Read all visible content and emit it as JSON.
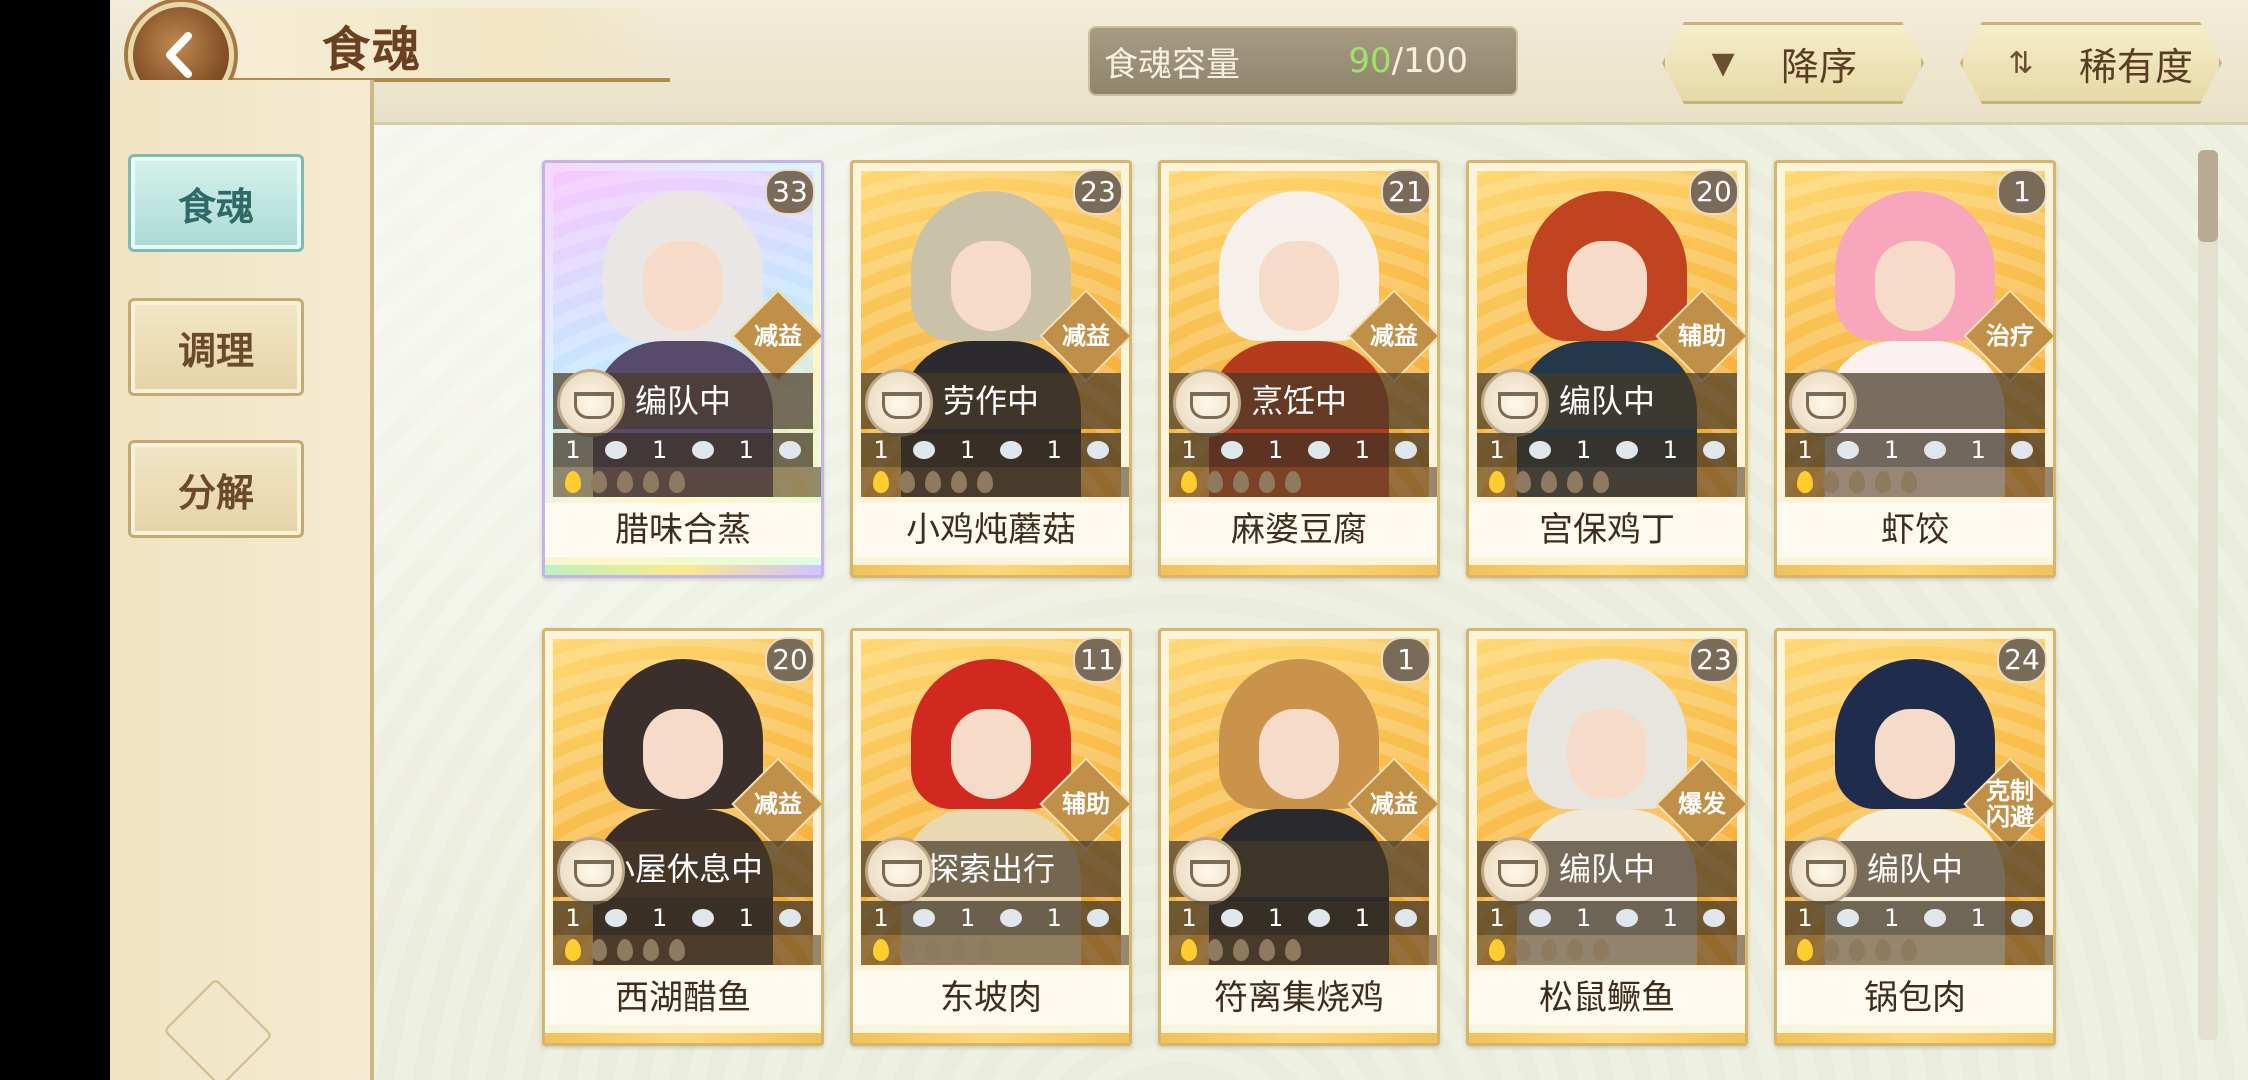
{
  "header": {
    "title": "食魂",
    "capacity_label": "食魂容量",
    "capacity_current": "90",
    "capacity_total": "/100",
    "sort_order_label": "降序",
    "sort_rarity_label": "稀有度"
  },
  "sidebar": {
    "items": [
      {
        "label": "食魂",
        "active": true
      },
      {
        "label": "调理",
        "active": false
      },
      {
        "label": "分解",
        "active": false
      }
    ]
  },
  "cards": [
    {
      "name": "腊味合蒸",
      "level": "33",
      "role": "减益",
      "status": "编队中",
      "stats": [
        "1",
        "1",
        "1"
      ],
      "flames": 1,
      "rarity": "rainbow",
      "hair": "#eae6e3",
      "outfit": "#574a6d"
    },
    {
      "name": "小鸡炖蘑菇",
      "level": "23",
      "role": "减益",
      "status": "劳作中",
      "stats": [
        "1",
        "1",
        "1"
      ],
      "flames": 1,
      "rarity": "gold",
      "hair": "#c9c1a8",
      "outfit": "#2c2a2e"
    },
    {
      "name": "麻婆豆腐",
      "level": "21",
      "role": "减益",
      "status": "烹饪中",
      "stats": [
        "1",
        "1",
        "1"
      ],
      "flames": 1,
      "rarity": "gold",
      "hair": "#f5f0ea",
      "outfit": "#b53b1e"
    },
    {
      "name": "宫保鸡丁",
      "level": "20",
      "role": "辅助",
      "status": "编队中",
      "stats": [
        "1",
        "1",
        "1"
      ],
      "flames": 1,
      "rarity": "gold",
      "hair": "#c0441f",
      "outfit": "#23384a"
    },
    {
      "name": "虾饺",
      "level": "1",
      "role": "治疗",
      "status": "",
      "stats": [
        "1",
        "1",
        "1"
      ],
      "flames": 1,
      "rarity": "gold",
      "hair": "#f7a6bb",
      "outfit": "#fbf1f0"
    },
    {
      "name": "西湖醋鱼",
      "level": "20",
      "role": "减益",
      "status": "小屋休息中",
      "stats": [
        "1",
        "1",
        "1"
      ],
      "flames": 1,
      "rarity": "gold",
      "hair": "#3a2f2b",
      "outfit": "#3b2e28"
    },
    {
      "name": "东坡肉",
      "level": "11",
      "role": "辅助",
      "status": "探索出行",
      "stats": [
        "1",
        "1",
        "1"
      ],
      "flames": 1,
      "rarity": "gold",
      "hair": "#d1281f",
      "outfit": "#e9d8b2"
    },
    {
      "name": "符离集烧鸡",
      "level": "1",
      "role": "减益",
      "status": "",
      "stats": [
        "1",
        "1",
        "1"
      ],
      "flames": 1,
      "rarity": "gold",
      "hair": "#c9934c",
      "outfit": "#2a2a2e"
    },
    {
      "name": "松鼠鳜鱼",
      "level": "23",
      "role": "爆发",
      "status": "编队中",
      "stats": [
        "1",
        "1",
        "1"
      ],
      "flames": 1,
      "rarity": "gold",
      "hair": "#e8e4de",
      "outfit": "#f0e9d9"
    },
    {
      "name": "锅包肉",
      "level": "24",
      "role": "克制\n闪避",
      "status": "编队中",
      "stats": [
        "1",
        "1",
        "1"
      ],
      "flames": 1,
      "rarity": "gold",
      "hair": "#1f2c4c",
      "outfit": "#f6eed8"
    }
  ]
}
